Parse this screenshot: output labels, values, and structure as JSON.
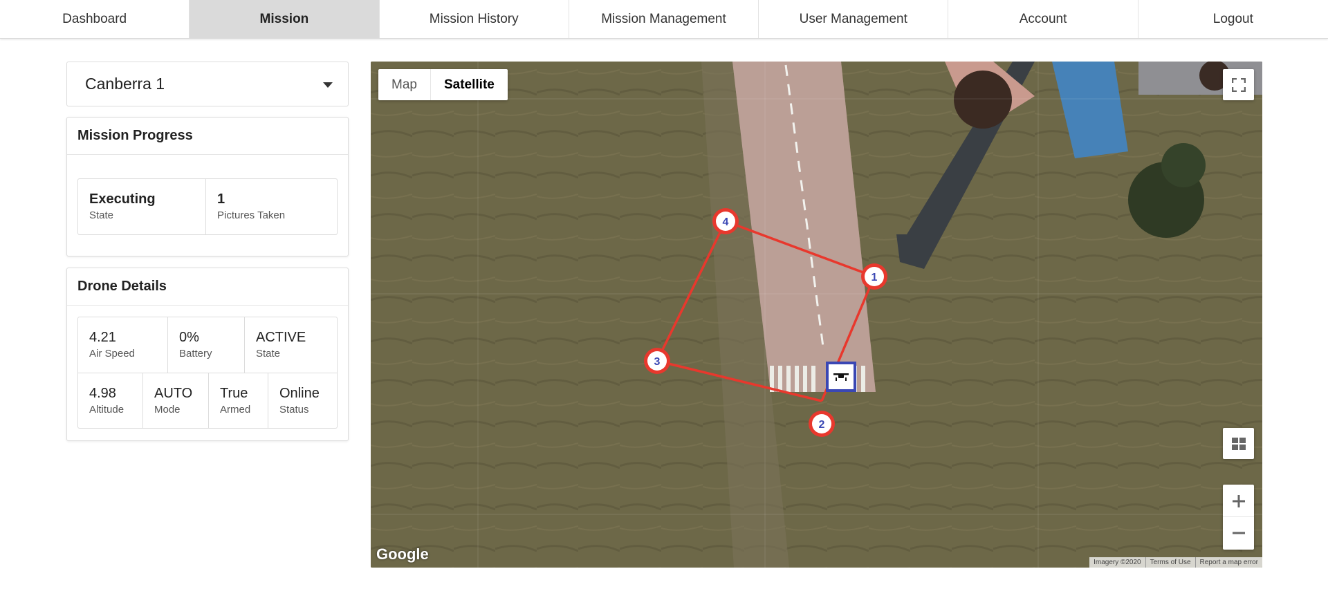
{
  "nav": {
    "tabs": [
      {
        "label": "Dashboard",
        "active": false
      },
      {
        "label": "Mission",
        "active": true
      },
      {
        "label": "Mission History",
        "active": false
      },
      {
        "label": "Mission Management",
        "active": false
      },
      {
        "label": "User Management",
        "active": false
      },
      {
        "label": "Account",
        "active": false
      },
      {
        "label": "Logout",
        "active": false
      }
    ]
  },
  "mission_select": {
    "value": "Canberra 1"
  },
  "mission_progress": {
    "title": "Mission Progress",
    "stats": [
      {
        "value": "Executing",
        "label": "State"
      },
      {
        "value": "1",
        "label": "Pictures Taken"
      }
    ]
  },
  "drone_details": {
    "title": "Drone Details",
    "row1": [
      {
        "value": "4.21",
        "label": "Air Speed"
      },
      {
        "value": "0%",
        "label": "Battery"
      },
      {
        "value": "ACTIVE",
        "label": "State"
      }
    ],
    "row2": [
      {
        "value": "4.98",
        "label": "Altitude"
      },
      {
        "value": "AUTO",
        "label": "Mode"
      },
      {
        "value": "True",
        "label": "Armed"
      },
      {
        "value": "Online",
        "label": "Status"
      }
    ]
  },
  "map": {
    "type_buttons": {
      "map": "Map",
      "satellite": "Satellite",
      "selected": "Satellite"
    },
    "waypoints": [
      "1",
      "2",
      "3",
      "4"
    ],
    "route_color": "#e8382d",
    "drone_marker_color": "#3a47b4",
    "logo": "Google",
    "attribution": {
      "imagery": "Imagery ©2020",
      "terms": "Terms of Use",
      "report": "Report a map error"
    },
    "icons": [
      "fullscreen-icon",
      "layers-icon",
      "zoom-in-icon",
      "zoom-out-icon",
      "drone-icon"
    ]
  }
}
